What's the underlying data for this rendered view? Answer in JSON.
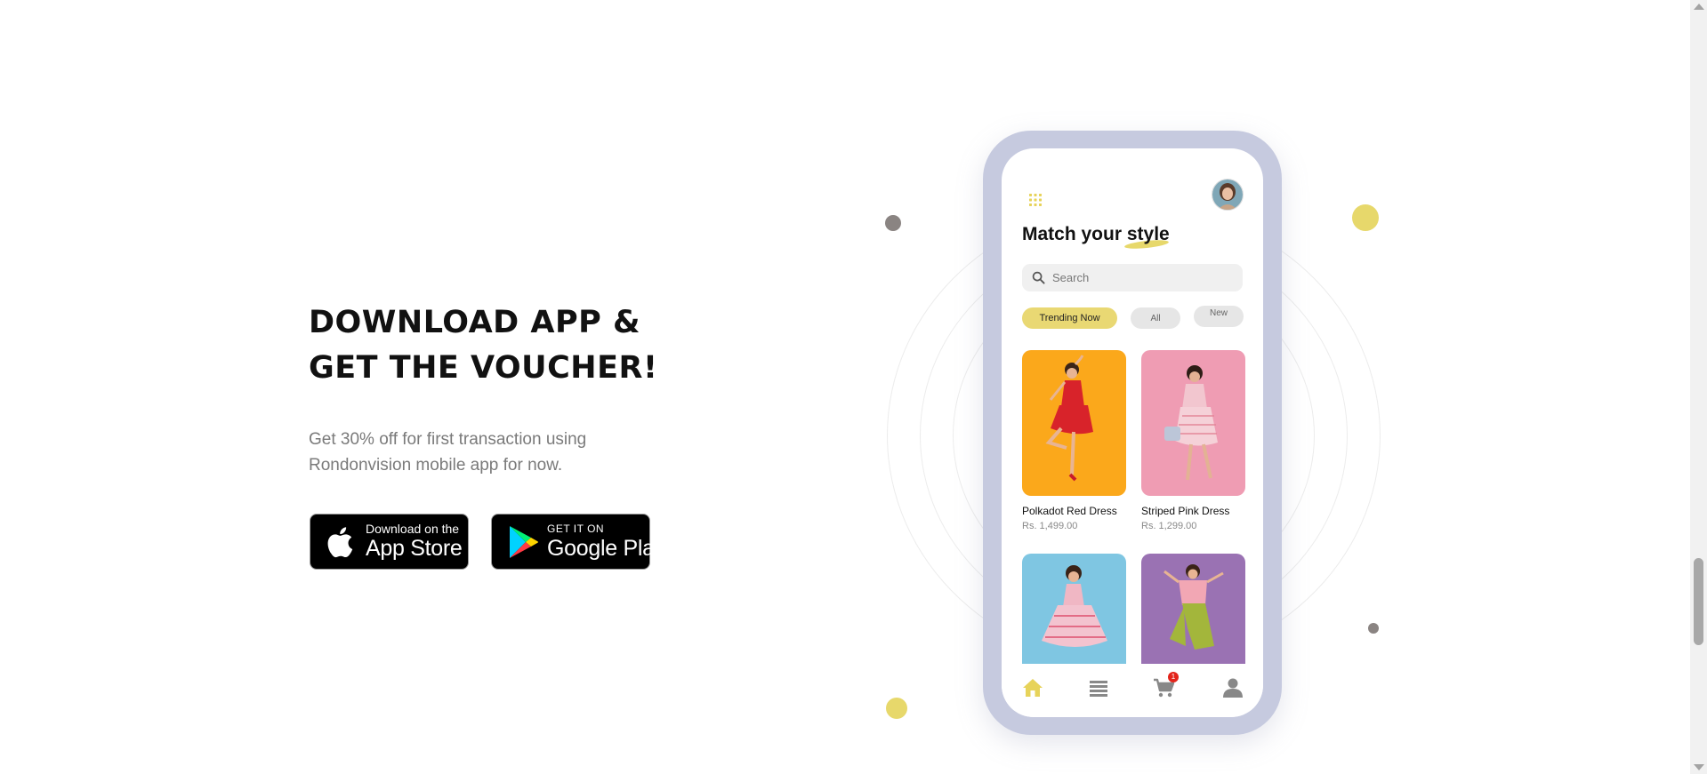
{
  "promo": {
    "title_line1": "DOWNLOAD APP &",
    "title_line2": "GET THE VOUCHER!",
    "text_line1": "Get 30% off for first transaction using",
    "text_line2": "Rondonvision mobile app for now."
  },
  "badges": {
    "apple": {
      "small": "Download on the",
      "big": "App Store",
      "icon": "apple-icon"
    },
    "google": {
      "small": "GET IT ON",
      "big": "Google Play",
      "icon": "google-play-icon"
    }
  },
  "app": {
    "heading_prefix": "Match your",
    "heading_highlight": "style",
    "search_placeholder": "Search",
    "filters": [
      "Trending Now",
      "All",
      "New"
    ],
    "products": [
      {
        "name": "Polkadot Red Dress",
        "price": "Rs.  1,499.00",
        "bg": "#fba81b"
      },
      {
        "name": "Striped Pink Dress",
        "price": "Rs.  1,299.00",
        "bg": "#ef9cb3"
      },
      {
        "name": "",
        "price": "",
        "bg": "#7fc6e2"
      },
      {
        "name": "",
        "price": "",
        "bg": "#9a72b3"
      }
    ],
    "nav": {
      "items": [
        "home-icon",
        "list-icon",
        "cart-icon",
        "user-icon"
      ],
      "cart_count": "1"
    }
  },
  "colors": {
    "accent_yellow": "#e9d873",
    "phone_frame": "#c6cadf",
    "dot_gray": "#8a8482",
    "cart_badge": "#e3241b"
  }
}
